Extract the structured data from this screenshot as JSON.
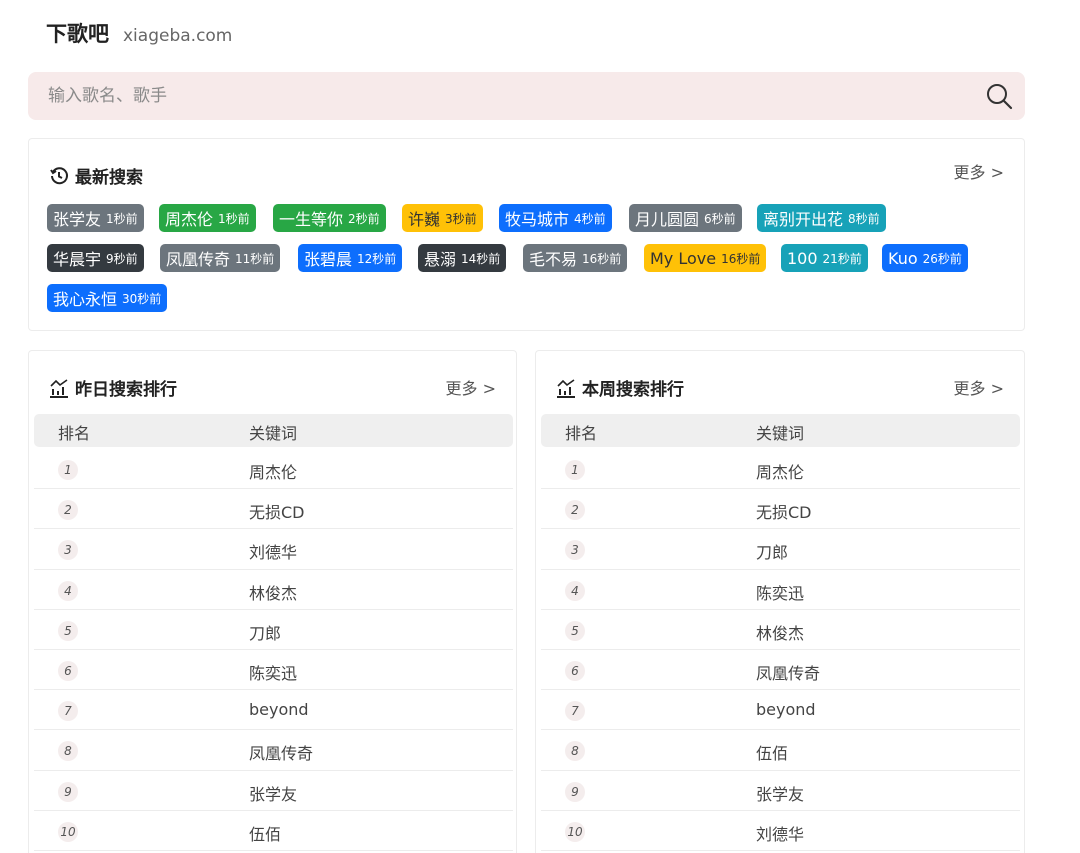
{
  "site": {
    "name": "下歌吧",
    "domain": "xiageba.com"
  },
  "search": {
    "placeholder": "输入歌名、歌手",
    "icon": "search-icon"
  },
  "recent": {
    "title": "最新搜索",
    "more": "更多 >",
    "tags": [
      {
        "keyword": "张学友",
        "ago": "1秒前",
        "color": "#6c757d"
      },
      {
        "keyword": "周杰伦",
        "ago": "1秒前",
        "color": "#28a745"
      },
      {
        "keyword": "一生等你",
        "ago": "2秒前",
        "color": "#28a745"
      },
      {
        "keyword": "许巍",
        "ago": "3秒前",
        "color": "#ffc107"
      },
      {
        "keyword": "牧马城市",
        "ago": "4秒前",
        "color": "#0d6efd"
      },
      {
        "keyword": "月儿圆圆",
        "ago": "6秒前",
        "color": "#6c757d"
      },
      {
        "keyword": "离别开出花",
        "ago": "8秒前",
        "color": "#17a2b8"
      },
      {
        "keyword": "华晨宇",
        "ago": "9秒前",
        "color": "#343a40"
      },
      {
        "keyword": "凤凰传奇",
        "ago": "11秒前",
        "color": "#6c757d"
      },
      {
        "keyword": "张碧晨",
        "ago": "12秒前",
        "color": "#0d6efd"
      },
      {
        "keyword": "悬溺",
        "ago": "14秒前",
        "color": "#343a40"
      },
      {
        "keyword": "毛不易",
        "ago": "16秒前",
        "color": "#6c757d"
      },
      {
        "keyword": "My Love",
        "ago": "16秒前",
        "color": "#ffc107"
      },
      {
        "keyword": "100",
        "ago": "21秒前",
        "color": "#17a2b8"
      },
      {
        "keyword": "Kuo",
        "ago": "26秒前",
        "color": "#0d6efd"
      },
      {
        "keyword": "我心永恒",
        "ago": "30秒前",
        "color": "#0d6efd"
      }
    ]
  },
  "yesterday": {
    "title": "昨日搜索排行",
    "more": "更多 >",
    "col_rank": "排名",
    "col_keyword": "关键词",
    "rows": [
      {
        "rank": "1",
        "keyword": "周杰伦"
      },
      {
        "rank": "2",
        "keyword": "无损CD"
      },
      {
        "rank": "3",
        "keyword": "刘德华"
      },
      {
        "rank": "4",
        "keyword": "林俊杰"
      },
      {
        "rank": "5",
        "keyword": "刀郎"
      },
      {
        "rank": "6",
        "keyword": "陈奕迅"
      },
      {
        "rank": "7",
        "keyword": "beyond"
      },
      {
        "rank": "8",
        "keyword": "凤凰传奇"
      },
      {
        "rank": "9",
        "keyword": "张学友"
      },
      {
        "rank": "10",
        "keyword": "伍佰"
      }
    ]
  },
  "week": {
    "title": "本周搜索排行",
    "more": "更多 >",
    "col_rank": "排名",
    "col_keyword": "关键词",
    "rows": [
      {
        "rank": "1",
        "keyword": "周杰伦"
      },
      {
        "rank": "2",
        "keyword": "无损CD"
      },
      {
        "rank": "3",
        "keyword": "刀郎"
      },
      {
        "rank": "4",
        "keyword": "陈奕迅"
      },
      {
        "rank": "5",
        "keyword": "林俊杰"
      },
      {
        "rank": "6",
        "keyword": "凤凰传奇"
      },
      {
        "rank": "7",
        "keyword": "beyond"
      },
      {
        "rank": "8",
        "keyword": "伍佰"
      },
      {
        "rank": "9",
        "keyword": "张学友"
      },
      {
        "rank": "10",
        "keyword": "刘德华"
      }
    ]
  }
}
